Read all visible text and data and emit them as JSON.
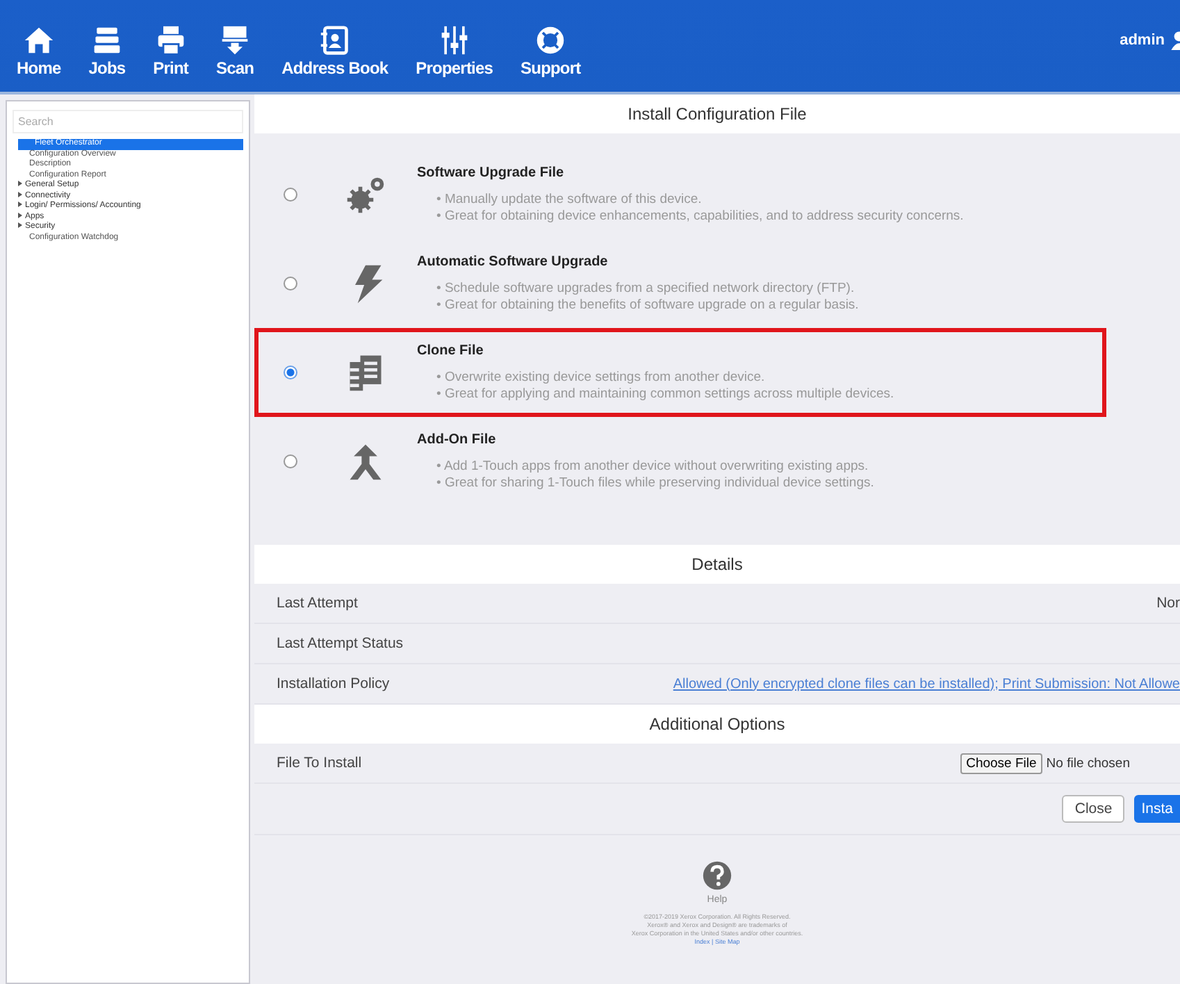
{
  "nav": {
    "items": [
      {
        "label": "Home"
      },
      {
        "label": "Jobs"
      },
      {
        "label": "Print"
      },
      {
        "label": "Scan"
      },
      {
        "label": "Address Book"
      },
      {
        "label": "Properties"
      },
      {
        "label": "Support"
      }
    ],
    "user": "admin"
  },
  "sidebar": {
    "search": {
      "placeholder": "Search"
    },
    "items": [
      {
        "label": "Fleet Orchestrator",
        "kind": "page",
        "selected": true
      },
      {
        "label": "Configuration Overview",
        "kind": "page",
        "selected": false
      },
      {
        "label": "Description",
        "kind": "page",
        "selected": false
      },
      {
        "label": "Configuration Report",
        "kind": "page",
        "selected": false
      },
      {
        "label": "General Setup",
        "kind": "group",
        "expanded": false,
        "selected": false
      },
      {
        "label": "Connectivity",
        "kind": "group",
        "expanded": false,
        "selected": false
      },
      {
        "label": "Login/ Permissions/ Accounting",
        "kind": "group",
        "expanded": false,
        "selected": false
      },
      {
        "label": "Apps",
        "kind": "group",
        "expanded": false,
        "selected": false
      },
      {
        "label": "Security",
        "kind": "group",
        "expanded": false,
        "selected": false
      },
      {
        "label": "Configuration Watchdog",
        "kind": "page",
        "selected": false
      }
    ]
  },
  "install": {
    "title": "Install Configuration File",
    "options": [
      {
        "title": "Software Upgrade File",
        "selected": false,
        "highlighted": false,
        "bullets": [
          "• Manually update the software of this device.",
          "• Great for obtaining device enhancements, capabilities, and to address security concerns."
        ]
      },
      {
        "title": "Automatic Software Upgrade",
        "selected": false,
        "highlighted": false,
        "bullets": [
          "• Schedule software upgrades from a specified network directory (FTP).",
          "• Great for obtaining the benefits of software upgrade on a regular basis."
        ]
      },
      {
        "title": "Clone File",
        "selected": true,
        "highlighted": true,
        "bullets": [
          "• Overwrite existing device settings from another device.",
          "• Great for applying and maintaining common settings across multiple devices."
        ]
      },
      {
        "title": "Add-On File",
        "selected": false,
        "highlighted": false,
        "bullets": [
          "• Add 1-Touch apps from another device without overwriting existing apps.",
          "• Great for sharing 1-Touch files while preserving individual device settings."
        ]
      }
    ]
  },
  "details": {
    "title": "Details",
    "rows": [
      {
        "label": "Last Attempt",
        "value": "Nor",
        "kind": "text"
      },
      {
        "label": "Last Attempt Status"
      },
      {
        "label": "Installation Policy",
        "value": "Allowed (Only encrypted clone files can be installed); Print Submission: Not Allowe",
        "kind": "link"
      }
    ]
  },
  "additional_options": {
    "title": "Additional Options",
    "file_label": "File To Install",
    "choose_button": "Choose File",
    "file_status": "No file chosen"
  },
  "buttons": [
    {
      "label": "Close",
      "primary": false
    },
    {
      "label": "Insta",
      "primary": true
    }
  ],
  "footer": {
    "help": "Help",
    "lines": [
      "©2017-2019 Xerox Corporation. All Rights Reserved.",
      "Xerox® and Xerox and Design® are trademarks of",
      "Xerox Corporation in the United States and/or other countries."
    ],
    "links": "Index | Site Map"
  }
}
